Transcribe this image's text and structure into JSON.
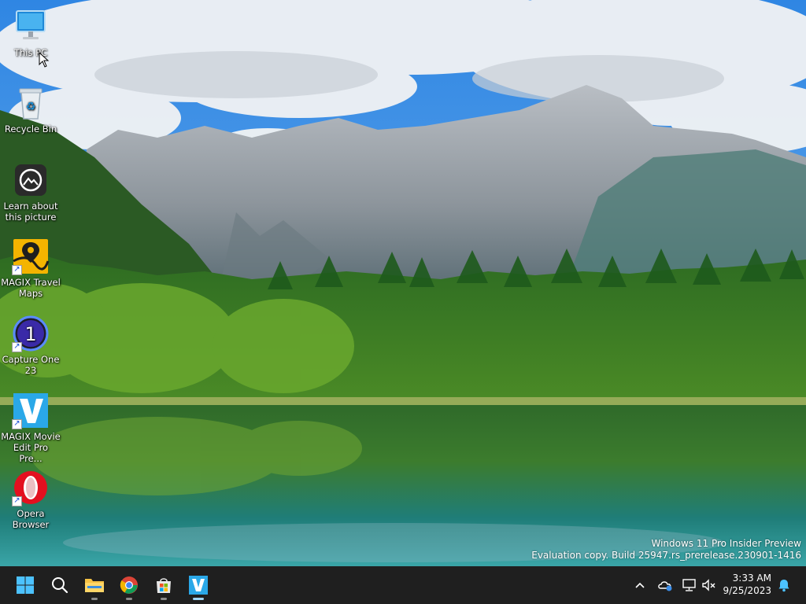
{
  "desktop": {
    "icons": [
      {
        "label": "This PC",
        "icon": "monitor-icon"
      },
      {
        "label": "Recycle Bin",
        "icon": "recycle-bin-icon"
      },
      {
        "label": "Learn about this picture",
        "icon": "camera-info-icon"
      },
      {
        "label": "MAGIX Travel Maps",
        "icon": "map-pin-icon"
      },
      {
        "label": "Capture One 23",
        "icon": "capture-one-icon"
      },
      {
        "label": "MAGIX Movie Edit Pro Pre...",
        "icon": "magix-v-icon"
      },
      {
        "label": "Opera Browser",
        "icon": "opera-icon"
      }
    ]
  },
  "watermark": {
    "line1": "Windows 11 Pro Insider Preview",
    "line2": "Evaluation copy. Build 25947.rs_prerelease.230901-1416"
  },
  "taskbar": {
    "apps": [
      {
        "name": "Start",
        "icon": "windows-start-icon"
      },
      {
        "name": "Search",
        "icon": "search-icon"
      },
      {
        "name": "File Explorer",
        "icon": "folder-icon"
      },
      {
        "name": "Google Chrome",
        "icon": "chrome-icon"
      },
      {
        "name": "Microsoft Store",
        "icon": "store-icon"
      },
      {
        "name": "MAGIX Movie Edit Pro",
        "icon": "magix-v-icon"
      }
    ],
    "tray": {
      "icons": [
        "chevron-up-icon",
        "onedrive-icon",
        "network-icon",
        "volume-muted-icon",
        "notification-bell-icon"
      ],
      "time": "3:33 AM",
      "date": "9/25/2023"
    }
  },
  "colors": {
    "taskbar_bg": "#1f1f1f",
    "accent": "#1a73e8",
    "opera_red": "#e3101f",
    "magix_blue": "#2aa8e8"
  }
}
